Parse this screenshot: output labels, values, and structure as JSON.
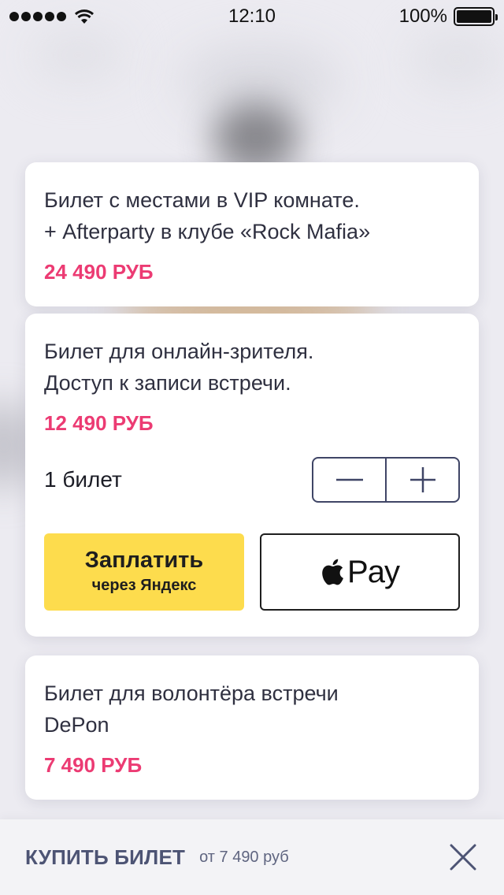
{
  "status_bar": {
    "time": "12:10",
    "battery_text": "100%",
    "battery_level": 1.0
  },
  "tickets": [
    {
      "title": "Билет с местами в VIP комнате.\n+ Afterparty в клубе «Rock Mafia»",
      "price": "24 490 РУБ"
    },
    {
      "title": "Билет для онлайн-зрителя.\nДоступ к записи встречи.",
      "price": "12 490 РУБ",
      "quantity_label": "1 билет",
      "pay_yandex_main": "Заплатить",
      "pay_yandex_sub": "через Яндекс",
      "apple_pay_text": "Pay"
    },
    {
      "title": "Билет для волонтёра встречи\nDePon",
      "price": "7 490 РУБ"
    }
  ],
  "bottom_bar": {
    "buy_label": "КУПИТЬ БИЛЕТ",
    "from_price": "от 7 490 руб"
  },
  "colors": {
    "price": "#ec3b73",
    "yandex_button": "#fddc4d",
    "stepper_border": "#3f4566",
    "bottom_label": "#4d5474"
  },
  "icons": {
    "status": [
      "signal-dots-icon",
      "wifi-icon",
      "battery-icon"
    ],
    "stepper": [
      "minus-icon",
      "plus-icon"
    ],
    "apple": "apple-logo-icon",
    "close": "close-icon"
  }
}
